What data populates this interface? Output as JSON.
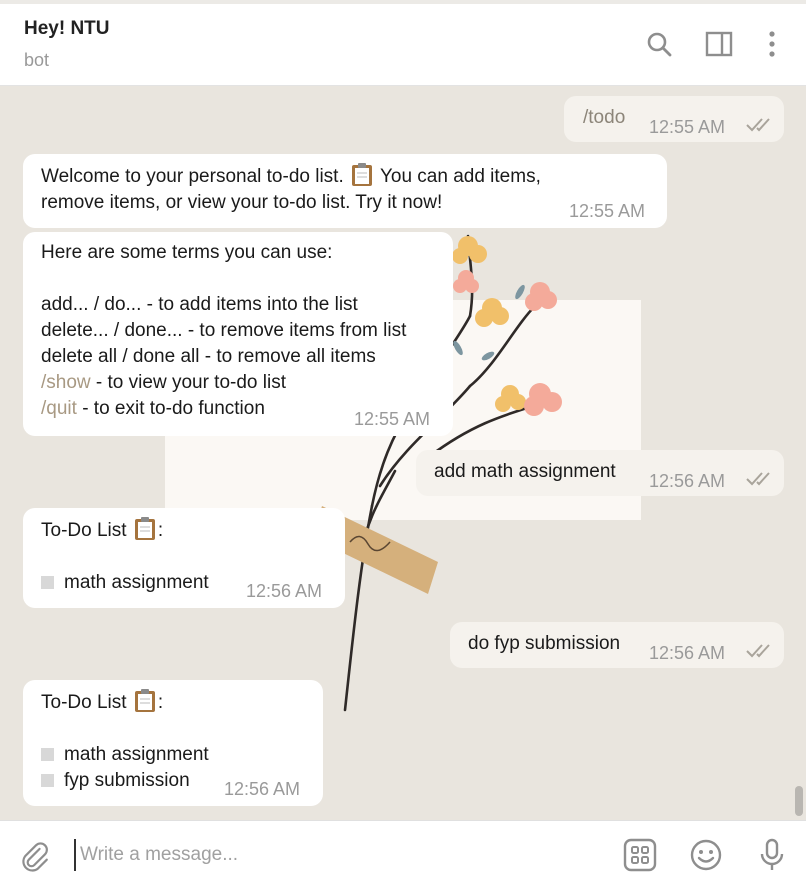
{
  "header": {
    "title": "Hey! NTU",
    "subtitle": "bot"
  },
  "messages": {
    "m1": {
      "text": "/todo",
      "time": "12:55 AM",
      "status": "read"
    },
    "m2": {
      "line1_a": "Welcome to your personal to-do list.",
      "line1_b": "You can add items,",
      "line2": "remove items, or view your to-do list. Try it now!",
      "time": "12:55 AM"
    },
    "m3": {
      "intro": "Here are some terms you can use:",
      "l1": "add... / do... - to add items into the list",
      "l2": "delete... / done... - to remove items from list",
      "l3": "delete all / done all - to remove all items",
      "l4_cmd": "/show",
      "l4_rest": " - to view your to-do list",
      "l5_cmd": "/quit",
      "l5_rest": " - to exit to-do function",
      "time": "12:55 AM"
    },
    "m4": {
      "text": "add math assignment",
      "time": "12:56 AM",
      "status": "read"
    },
    "m5": {
      "heading": "To-Do List",
      "suffix": ":",
      "items": [
        "math assignment"
      ],
      "time": "12:56 AM"
    },
    "m6": {
      "text": "do fyp submission",
      "time": "12:56 AM",
      "status": "read"
    },
    "m7": {
      "heading": "To-Do List",
      "suffix": ":",
      "items": [
        "math assignment",
        "fyp submission"
      ],
      "time": "12:56 AM"
    }
  },
  "composer": {
    "placeholder": "Write a message..."
  },
  "icons": {
    "header": [
      "search-icon",
      "sidebar-toggle-icon",
      "more-vertical-icon"
    ],
    "composer": [
      "paperclip-icon",
      "bot-commands-icon",
      "emoji-icon",
      "microphone-icon"
    ]
  },
  "colors": {
    "chat_background": "#e9e5de",
    "incoming_bubble": "#ffffff",
    "outgoing_bubble": "#f5f2ed",
    "command_link": "#a89983"
  }
}
